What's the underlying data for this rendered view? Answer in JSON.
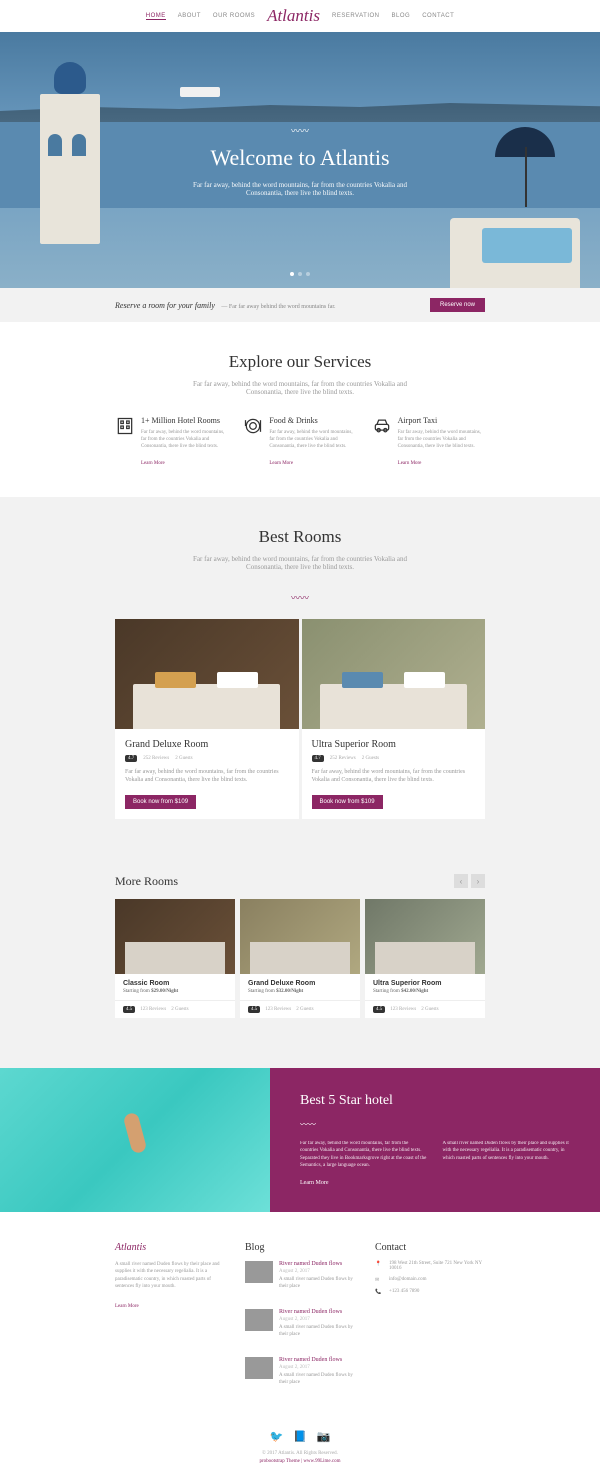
{
  "nav": {
    "items": [
      "HOME",
      "ABOUT",
      "OUR ROOMS"
    ],
    "items2": [
      "RESERVATION",
      "BLOG",
      "CONTACT"
    ],
    "logo": "Atlantis"
  },
  "hero": {
    "title": "Welcome to Atlantis",
    "sub": "Far far away, behind the word mountains, far from the countries Vokalia and Consonantia, there live the blind texts."
  },
  "reserve": {
    "title": "Reserve a room for your family",
    "sub": "— Far far away behind the word mountains far.",
    "btn": "Reserve now"
  },
  "services": {
    "title": "Explore our Services",
    "sub": "Far far away, behind the word mountains, far from the countries Vokalia and Consonantia, there live the blind texts.",
    "items": [
      {
        "title": "1+ Million Hotel Rooms",
        "desc": "Far far away, behind the word mountains, far from the countries Vokalia and Consonantia, there live the blind texts.",
        "link": "Learn More"
      },
      {
        "title": "Food & Drinks",
        "desc": "Far far away, behind the word mountains, far from the countries Vokalia and Consonantia, there live the blind texts.",
        "link": "Learn More"
      },
      {
        "title": "Airport Taxi",
        "desc": "Far far away, behind the word mountains, far from the countries Vokalia and Consonantia, there live the blind texts.",
        "link": "Learn More"
      }
    ]
  },
  "best": {
    "title": "Best Rooms",
    "sub": "Far far away, behind the word mountains, far from the countries Vokalia and Consonantia, there live the blind texts.",
    "rooms": [
      {
        "title": "Grand Deluxe Room",
        "rating": "4.7",
        "reviews": "252 Reviews",
        "guests": "2 Guests",
        "desc": "Far far away, behind the word mountains, far from the countries Vokalia and Consonantia, there live the blind texts.",
        "btn": "Book now from $109"
      },
      {
        "title": "Ultra Superior Room",
        "rating": "4.7",
        "reviews": "252 Reviews",
        "guests": "2 Guests",
        "desc": "Far far away, behind the word mountains, far from the countries Vokalia and Consonantia, there live the blind texts.",
        "btn": "Book now from $109"
      }
    ]
  },
  "more": {
    "title": "More Rooms",
    "rooms": [
      {
        "title": "Classic Room",
        "price": "Starting from ",
        "amount": "$29.00/Night",
        "rating": "4.5",
        "reviews": "123 Reviews",
        "guests": "2 Guests"
      },
      {
        "title": "Grand Deluxe Room",
        "price": "Starting from ",
        "amount": "$32.00/Night",
        "rating": "4.5",
        "reviews": "123 Reviews",
        "guests": "2 Guests"
      },
      {
        "title": "Ultra Superior Room",
        "price": "Starting from ",
        "amount": "$42.00/Night",
        "rating": "4.5",
        "reviews": "123 Reviews",
        "guests": "2 Guests"
      }
    ]
  },
  "fivestar": {
    "title": "Best 5 Star hotel",
    "p1": "Far far away, behind the word mountains, far from the countries Vokalia and Consonantia, there live the blind texts. Separated they live in Bookmarksgrove right at the coast of the Semantics, a large language ocean.",
    "p2": "A small river named Duden flows by their place and supplies it with the necessary regelialia. It is a paradisematic country, in which roasted parts of sentences fly into your mouth.",
    "link": "Learn More"
  },
  "footer": {
    "logo": "Atlantis",
    "about": "A small river named Duden flows by their place and supplies it with the necessary regelialia. It is a paradisematic country, in which roasted parts of sentences fly into your mouth.",
    "aboutLink": "Learn More",
    "blogTitle": "Blog",
    "blog": [
      {
        "title": "River named Duden flows",
        "date": "August 2, 2017",
        "desc": "A small river named Duden flows by their place"
      },
      {
        "title": "River named Duden flows",
        "date": "August 2, 2017",
        "desc": "A small river named Duden flows by their place"
      },
      {
        "title": "River named Duden flows",
        "date": "August 2, 2017",
        "desc": "A small river named Duden flows by their place"
      }
    ],
    "contactTitle": "Contact",
    "contact": {
      "address": "198 West 21th Street, Suite 721 New York NY 10016",
      "email": "info@domain.com",
      "phone": "+123 456 7890"
    },
    "copyright": "© 2017 Atlantis. All Rights Reserved.",
    "theme": "probootstrap Theme | www.99Lime.com"
  }
}
